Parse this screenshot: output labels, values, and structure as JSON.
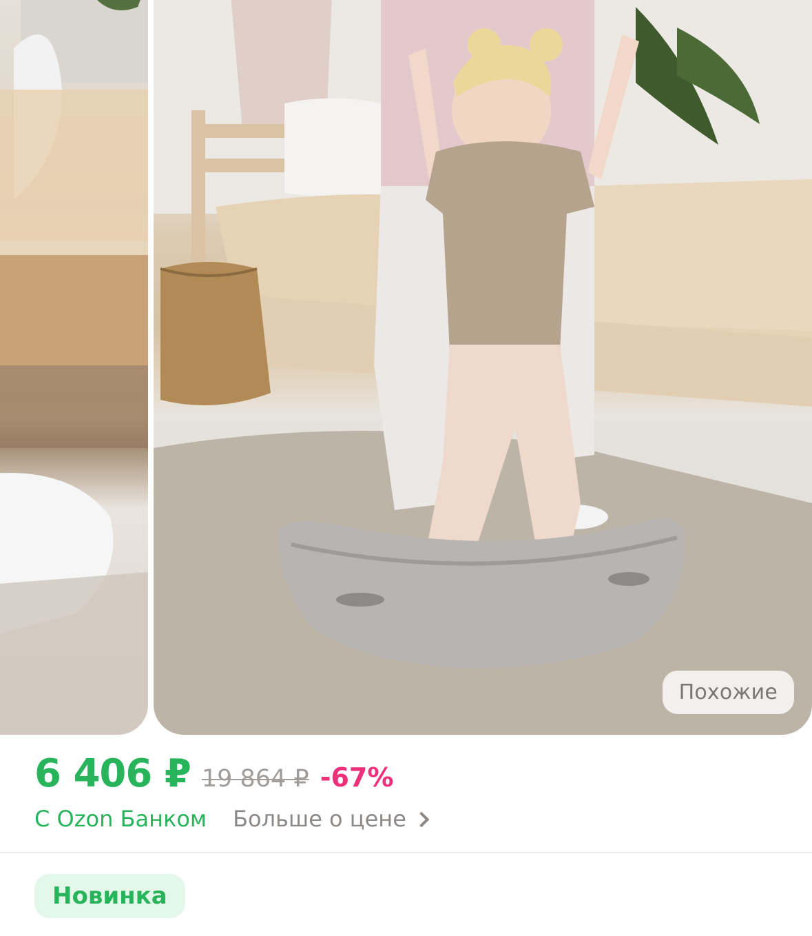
{
  "gallery": {
    "similar_label": "Похожие"
  },
  "price": {
    "current": "6 406 ₽",
    "old": "19 864 ₽",
    "discount": "-67%",
    "bank_label": "С Ozon Банком",
    "more_label": "Больше о цене"
  },
  "badges": {
    "new_label": "Новинка"
  },
  "colors": {
    "accent_green": "#27b45a",
    "discount_pink": "#ee2f7a",
    "badge_bg": "#e4f8ea"
  },
  "icons": [
    "chevron-right-icon"
  ]
}
